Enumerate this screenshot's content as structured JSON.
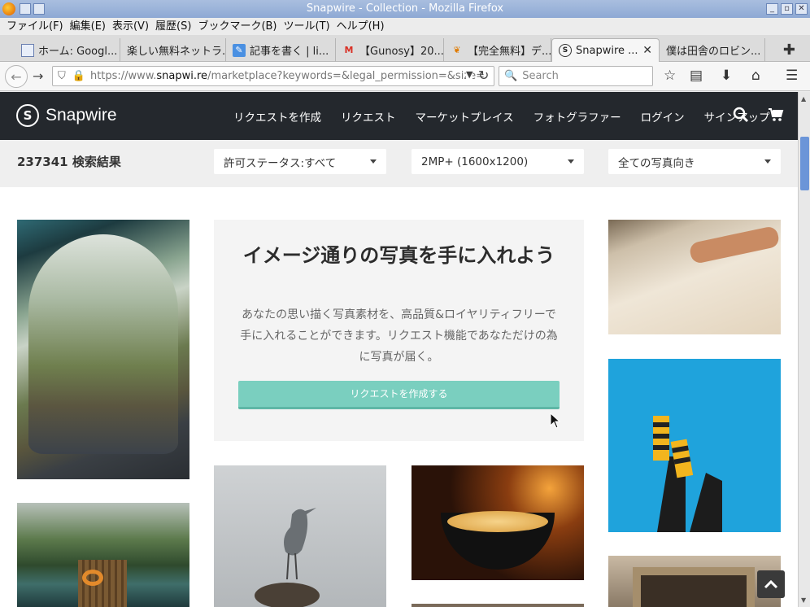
{
  "window": {
    "title": "Snapwire - Collection - Mozilla Firefox"
  },
  "menubar": [
    "ファイル(F)",
    "編集(E)",
    "表示(V)",
    "履歴(S)",
    "ブックマーク(B)",
    "ツール(T)",
    "ヘルプ(H)"
  ],
  "tabs": [
    {
      "label": "ホーム: Googl...",
      "icon": "feed-icon"
    },
    {
      "label": "楽しい無料ネットラ...",
      "icon": "none"
    },
    {
      "label": "記事を書く | li...",
      "icon": "edit-icon"
    },
    {
      "label": "【Gunosy】20...",
      "icon": "gmail-icon"
    },
    {
      "label": "【完全無料】デ...",
      "icon": "leaf-icon"
    },
    {
      "label": "Snapwire ...",
      "icon": "snapwire-icon",
      "active": true
    },
    {
      "label": "僕は田舎のロビン...",
      "icon": "none"
    }
  ],
  "nav": {
    "url_prefix": "https://www.",
    "url_host": "snapwi.re",
    "url_rest": "/marketplace?keywords=&legal_permission=&size=",
    "search_placeholder": "Search"
  },
  "site": {
    "brand": "Snapwire",
    "nav": [
      "リクエストを作成",
      "リクエスト",
      "マーケットプレイス",
      "フォトグラファー",
      "ログイン",
      "サインアップ"
    ]
  },
  "filters": {
    "results": "237341 検索結果",
    "permission": "許可ステータス:すべて",
    "size": "2MP+ (1600x1200)",
    "orientation": "全ての写真向き"
  },
  "promo": {
    "title": "イメージ通りの写真を手に入れよう",
    "body": "あなたの思い描く写真素材を、高品質&ロイヤリティフリーで手に入れることができます。リクエスト機能であなただけの為に写真が届く。",
    "cta": "リクエストを作成する"
  },
  "colors": {
    "header_bg": "#24282d",
    "cta": "#7acfbf",
    "filter_bg": "#efefef"
  }
}
